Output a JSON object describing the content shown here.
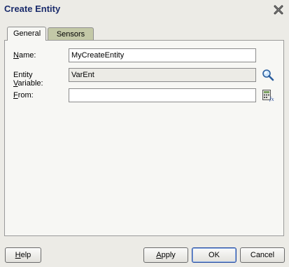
{
  "dialog": {
    "title": "Create Entity"
  },
  "tabs": [
    {
      "label": "General",
      "active": true
    },
    {
      "label": "Sensors",
      "active": false
    }
  ],
  "form": {
    "name": {
      "label_mnemonic": "N",
      "label_rest": "ame:",
      "value": "MyCreateEntity"
    },
    "entity_variable": {
      "label_pre": "Entity ",
      "label_mnemonic": "V",
      "label_rest": "ariable:",
      "value": "VarEnt"
    },
    "from": {
      "label_mnemonic": "F",
      "label_rest": "rom:",
      "value": ""
    }
  },
  "buttons": {
    "help": {
      "mnemonic": "H",
      "rest": "elp"
    },
    "apply": {
      "mnemonic": "A",
      "rest": "pply"
    },
    "ok": {
      "label": "OK"
    },
    "cancel": {
      "label": "Cancel"
    }
  },
  "icons": {
    "close": "close-icon",
    "search": "magnifier-icon",
    "expression": "expression-builder-icon"
  }
}
